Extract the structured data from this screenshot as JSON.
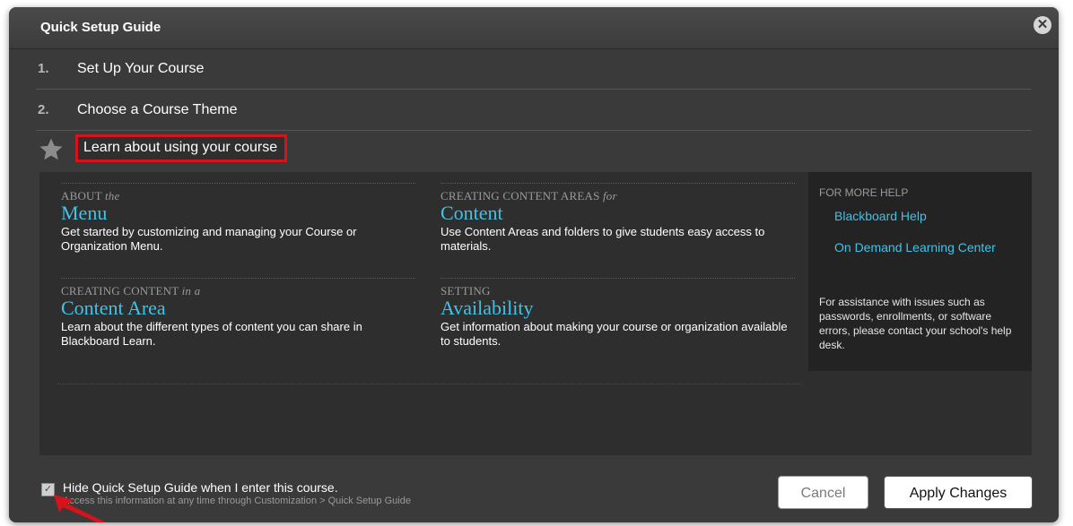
{
  "dialog": {
    "title": "Quick Setup Guide",
    "close_icon": "close-icon"
  },
  "steps": [
    {
      "number": "1.",
      "label": "Set Up Your Course"
    },
    {
      "number": "2.",
      "label": "Choose a Course Theme"
    },
    {
      "icon": "star-icon",
      "label": "Learn about using your course"
    }
  ],
  "topics": [
    {
      "kicker": "ABOUT",
      "kicker_italic": "the",
      "title": "Menu",
      "desc": "Get started by customizing and managing your Course or Organization Menu."
    },
    {
      "kicker": "CREATING CONTENT AREAS",
      "kicker_italic": "for",
      "title": "Content",
      "desc": "Use Content Areas and folders to give students easy access to materials."
    },
    {
      "kicker": "CREATING CONTENT",
      "kicker_italic": "in a",
      "title": "Content Area",
      "desc": "Learn about the different types of content you can share in Blackboard Learn."
    },
    {
      "kicker": "SETTING",
      "kicker_italic": "",
      "title": "Availability",
      "desc": "Get information about making your course or organization available to students."
    }
  ],
  "help": {
    "heading": "FOR MORE HELP",
    "links": [
      "Blackboard Help",
      "On Demand Learning Center"
    ],
    "note": "For assistance with issues such as passwords, enrollments, or software errors, please contact your school's help desk."
  },
  "footer": {
    "checkbox_checked": true,
    "checkbox_label": "Hide Quick Setup Guide when I enter this course.",
    "hint": "Access this information at any time through Customization > Quick Setup Guide",
    "cancel_label": "Cancel",
    "apply_label": "Apply Changes"
  },
  "colors": {
    "accent": "#3fc3e8",
    "highlight": "#d4131a"
  }
}
